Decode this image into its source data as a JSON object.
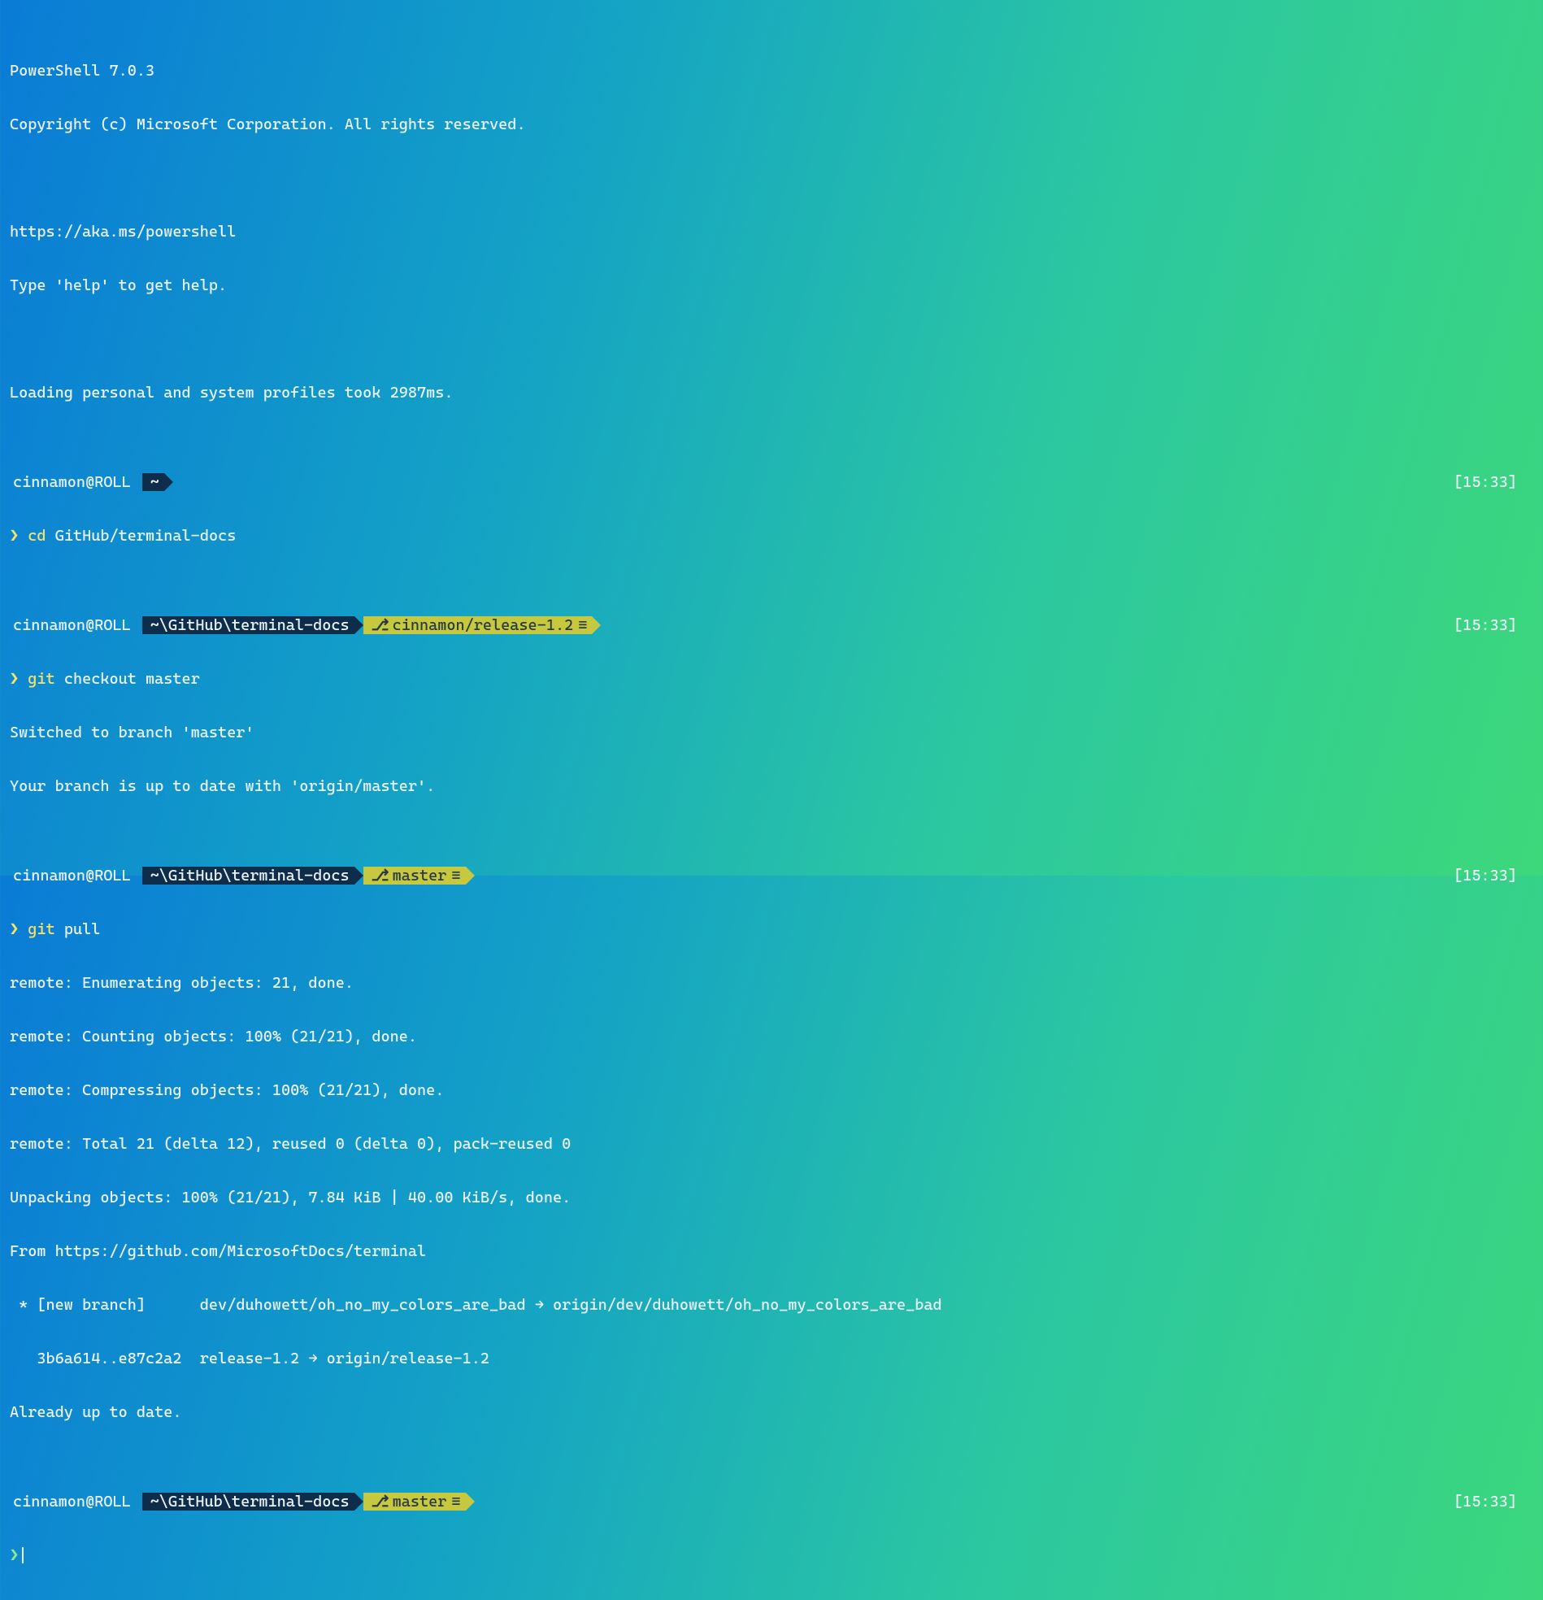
{
  "header": {
    "line1": "PowerShell 7.0.3",
    "line2": "Copyright (c) Microsoft Corporation. All rights reserved.",
    "link": "https://aka.ms/powershell",
    "help": "Type 'help' to get help.",
    "profiles": "Loading personal and system profiles took 2987ms."
  },
  "user_host": "cinnamon@ROLL",
  "paths": {
    "home": "~",
    "repo": "~\\GitHub\\terminal-docs"
  },
  "branches": {
    "release": "cinnamon/release-1.2",
    "master": "master"
  },
  "branch_status_glyph": "≡",
  "timestamps": {
    "t1": "[15:33]",
    "t2": "[15:33]",
    "t3": "[15:33]",
    "t4": "[15:33]"
  },
  "prompts": {
    "arrow": "❯",
    "branch_glyph": "⎇"
  },
  "commands": {
    "cd": {
      "cmd": "cd",
      "arg": "GitHub/terminal-docs"
    },
    "checkout": {
      "cmd": "git",
      "arg": "checkout master"
    },
    "pull": {
      "cmd": "git",
      "arg": "pull"
    }
  },
  "output": {
    "checkout1": "Switched to branch 'master'",
    "checkout2": "Your branch is up to date with 'origin/master'.",
    "pull": [
      "remote: Enumerating objects: 21, done.",
      "remote: Counting objects: 100% (21/21), done.",
      "remote: Compressing objects: 100% (21/21), done.",
      "remote: Total 21 (delta 12), reused 0 (delta 0), pack-reused 0",
      "Unpacking objects: 100% (21/21), 7.84 KiB | 40.00 KiB/s, done.",
      "From https://github.com/MicrosoftDocs/terminal",
      " * [new branch]      dev/duhowett/oh_no_my_colors_are_bad → origin/dev/duhowett/oh_no_my_colors_are_bad",
      "   3b6a614..e87c2a2  release-1.2 → origin/release-1.2",
      "Already up to date."
    ]
  }
}
